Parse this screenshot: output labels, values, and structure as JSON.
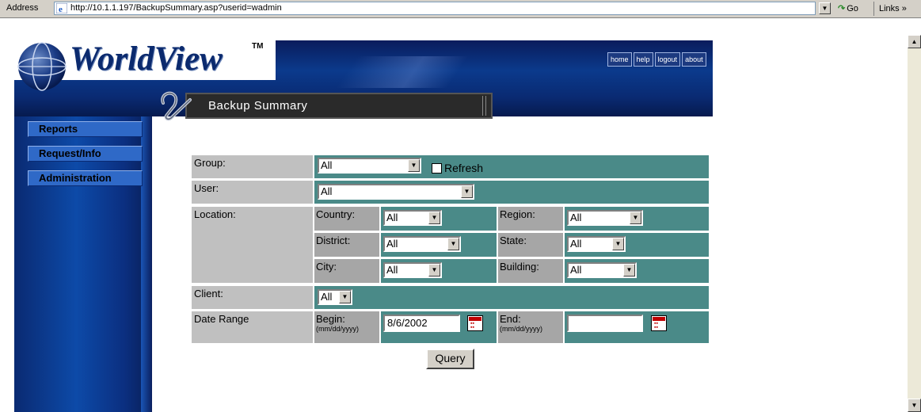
{
  "browser": {
    "address_label": "Address",
    "url": "http://10.1.1.197/BackupSummary.asp?userid=wadmin",
    "go_label": "Go",
    "links_label": "Links »"
  },
  "header": {
    "logo_main": "WorldView",
    "logo_tm": "TM",
    "links": [
      "home",
      "help",
      "logout",
      "about"
    ],
    "page_title": "Backup Summary"
  },
  "nav": {
    "items": [
      "Reports",
      "Request/Info",
      "Administration"
    ]
  },
  "form": {
    "group": {
      "label": "Group:",
      "value": "All",
      "refresh_label": "Refresh",
      "refresh_checked": false
    },
    "user": {
      "label": "User:",
      "value": "All"
    },
    "location": {
      "label": "Location:",
      "country": {
        "label": "Country:",
        "value": "All"
      },
      "region": {
        "label": "Region:",
        "value": "All"
      },
      "district": {
        "label": "District:",
        "value": "All"
      },
      "state": {
        "label": "State:",
        "value": "All"
      },
      "city": {
        "label": "City:",
        "value": "All"
      },
      "building": {
        "label": "Building:",
        "value": "All"
      }
    },
    "client": {
      "label": "Client:",
      "value": "All"
    },
    "date_range": {
      "label": "Date Range",
      "begin_label": "Begin:",
      "begin_hint": "(mm/dd/yyyy)",
      "begin_value": "8/6/2002",
      "end_label": "End:",
      "end_hint": "(mm/dd/yyyy)",
      "end_value": ""
    },
    "query_label": "Query"
  },
  "colors": {
    "field_cell": "#4a8a88",
    "label_cell": "#c0c0c0",
    "banner": "#0b3a8c"
  }
}
